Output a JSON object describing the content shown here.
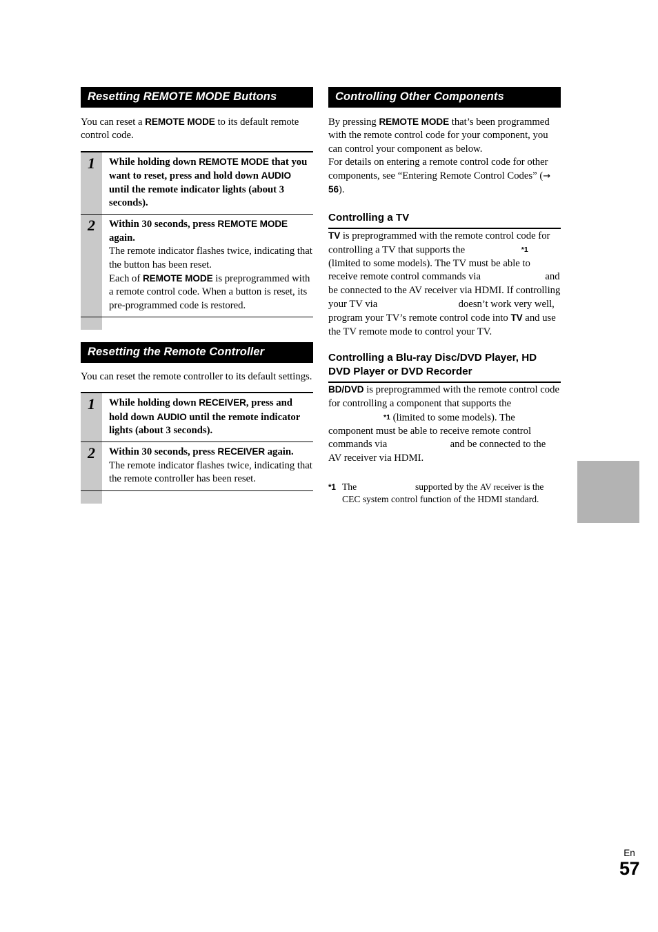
{
  "page": {
    "language_code": "En",
    "page_number": "57"
  },
  "left_column": {
    "section1": {
      "heading": "Resetting REMOTE MODE Buttons",
      "intro": {
        "before": "You can reset a ",
        "control": "REMOTE MODE",
        "after": " to its default remote control code."
      },
      "steps": [
        {
          "number": "1",
          "title_parts": [
            {
              "text": "While holding down ",
              "style": "bold-serif"
            },
            {
              "text": "REMOTE MODE",
              "style": "bold-sans"
            },
            {
              "text": " that you want to reset, press and hold down ",
              "style": "bold-serif"
            },
            {
              "text": "AUDIO",
              "style": "bold-sans"
            },
            {
              "text": " until the remote indicator lights (about 3 seconds).",
              "style": "bold-serif"
            }
          ],
          "notes": []
        },
        {
          "number": "2",
          "title_parts": [
            {
              "text": "Within 30 seconds, press ",
              "style": "bold-serif"
            },
            {
              "text": "REMOTE MODE",
              "style": "bold-sans"
            },
            {
              "text": " again.",
              "style": "bold-serif"
            }
          ],
          "notes": [
            [
              {
                "text": "The remote indicator flashes twice, indicating that the button has been reset.",
                "style": "normal"
              }
            ],
            [
              {
                "text": "Each of ",
                "style": "normal"
              },
              {
                "text": "REMOTE MODE",
                "style": "bold-sans"
              },
              {
                "text": " is preprogrammed with a remote control code. When a button is reset, its pre-programmed code is restored.",
                "style": "normal"
              }
            ]
          ]
        }
      ]
    },
    "section2": {
      "heading": "Resetting the Remote Controller",
      "intro": {
        "before": "You can reset the remote controller to its default settings.",
        "control": "",
        "after": ""
      },
      "steps": [
        {
          "number": "1",
          "title_parts": [
            {
              "text": "While holding down ",
              "style": "bold-serif"
            },
            {
              "text": "RECEIVER",
              "style": "bold-sans"
            },
            {
              "text": ", press and hold down ",
              "style": "bold-serif"
            },
            {
              "text": "AUDIO",
              "style": "bold-sans"
            },
            {
              "text": " until the remote indicator lights (about 3 seconds).",
              "style": "bold-serif"
            }
          ],
          "notes": []
        },
        {
          "number": "2",
          "title_parts": [
            {
              "text": "Within 30 seconds, press ",
              "style": "bold-serif"
            },
            {
              "text": "RECEIVER",
              "style": "bold-sans"
            },
            {
              "text": " again.",
              "style": "bold-serif"
            }
          ],
          "notes": [
            [
              {
                "text": "The remote indicator flashes twice, indicating that the remote controller has been reset.",
                "style": "normal"
              }
            ]
          ]
        }
      ]
    }
  },
  "right_column": {
    "section_heading": "Controlling Other Components",
    "intro_paragraphs": [
      [
        {
          "text": "By pressing ",
          "style": "normal"
        },
        {
          "text": "REMOTE MODE",
          "style": "bold-sans"
        },
        {
          "text": " that’s been programmed with the remote control code for your component, you can control your component as below.",
          "style": "normal"
        }
      ],
      [
        {
          "text": "For details on entering a remote control code for other components, see “Entering Remote Control Codes” (",
          "style": "normal"
        },
        {
          "text": "→",
          "style": "arrow"
        },
        {
          "text": " ",
          "style": "normal"
        },
        {
          "text": "56",
          "style": "bold-sans"
        },
        {
          "text": ").",
          "style": "normal"
        }
      ]
    ],
    "subsections": [
      {
        "heading": "Controlling a TV",
        "body": [
          {
            "text": "TV",
            "style": "bold-sans"
          },
          {
            "text": " is preprogrammed with the remote control code for controlling a TV that supports the ",
            "style": "normal"
          },
          {
            "text": "",
            "style": "logo-gap",
            "width": "78"
          },
          {
            "text": "*1",
            "style": "sup-mark"
          },
          {
            "text": " (limited to some models). The TV must be able to receive remote control commands via ",
            "style": "normal"
          },
          {
            "text": "",
            "style": "logo-gap",
            "width": "86"
          },
          {
            "text": " and be connected to the AV receiver via HDMI. If controlling your TV via ",
            "style": "normal"
          },
          {
            "text": "",
            "style": "logo-gap",
            "width": "110"
          },
          {
            "text": " doesn’t work very well, program your TV’s remote control code into ",
            "style": "normal"
          },
          {
            "text": "TV",
            "style": "bold-sans"
          },
          {
            "text": " and use the TV remote mode to control your TV.",
            "style": "normal"
          }
        ]
      },
      {
        "heading": "Controlling a Blu-ray Disc/DVD Player, HD DVD Player or DVD Recorder",
        "body": [
          {
            "text": "BD/DVD",
            "style": "bold-sans"
          },
          {
            "text": " is preprogrammed with the remote control code for controlling a component that supports the ",
            "style": "normal"
          },
          {
            "text": "",
            "style": "logo-gap",
            "width": "80"
          },
          {
            "text": "*1",
            "style": "sup-mark"
          },
          {
            "text": " (limited to some models). The component must be able to receive remote control commands via ",
            "style": "normal"
          },
          {
            "text": "",
            "style": "logo-gap",
            "width": "84"
          },
          {
            "text": " and be connected to the AV receiver via HDMI.",
            "style": "normal"
          }
        ]
      }
    ],
    "footnote": {
      "mark": "*1",
      "parts": [
        {
          "text": "The ",
          "style": "normal"
        },
        {
          "text": "",
          "style": "logo-gap",
          "width": "78"
        },
        {
          "text": " supported by the ",
          "style": "normal"
        },
        {
          "text": "AV receiver",
          "style": "small"
        },
        {
          "text": " is the CEC system control function of the HDMI standard.",
          "style": "normal"
        }
      ]
    }
  },
  "thumb_tab": {
    "color": "#b3b3b3"
  }
}
